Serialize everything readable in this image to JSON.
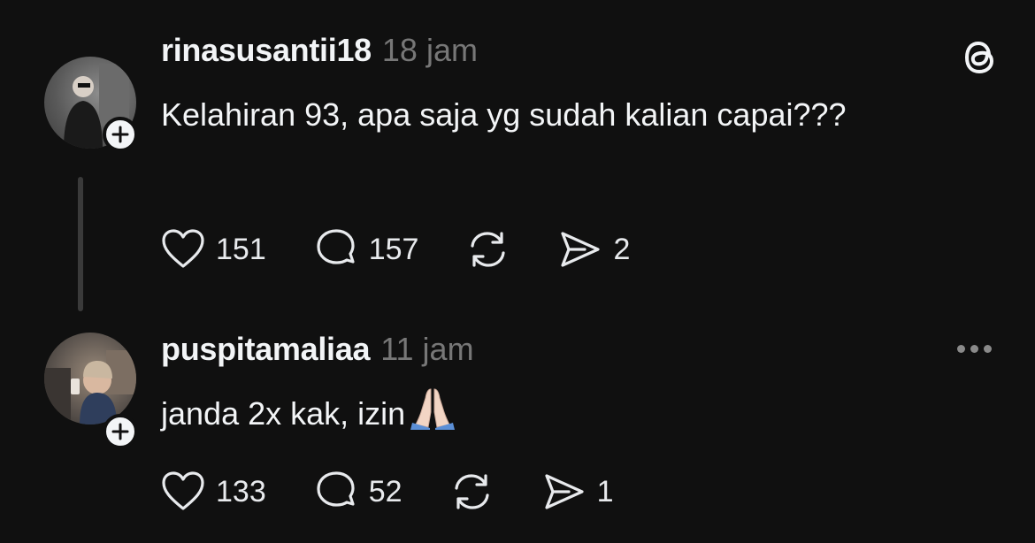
{
  "posts": [
    {
      "username": "rinasusantii18",
      "time": "18 jam",
      "text": "Kelahiran 93, apa saja yg sudah kalian capai???",
      "likes": "151",
      "replies": "157",
      "shares": "2",
      "icons": [
        "heart-icon",
        "comment-icon",
        "repost-icon",
        "share-icon"
      ]
    },
    {
      "username": "puspitamaliaa",
      "time": "11 jam",
      "text": "janda 2x kak, izin",
      "emoji": "folded-hands",
      "likes": "133",
      "replies": "52",
      "shares": "1",
      "icons": [
        "heart-icon",
        "comment-icon",
        "repost-icon",
        "share-icon"
      ]
    }
  ],
  "app": {
    "logo": "threads-logo-icon"
  },
  "colors": {
    "background": "#101010",
    "text": "#f3f5f7",
    "muted": "#777777"
  }
}
